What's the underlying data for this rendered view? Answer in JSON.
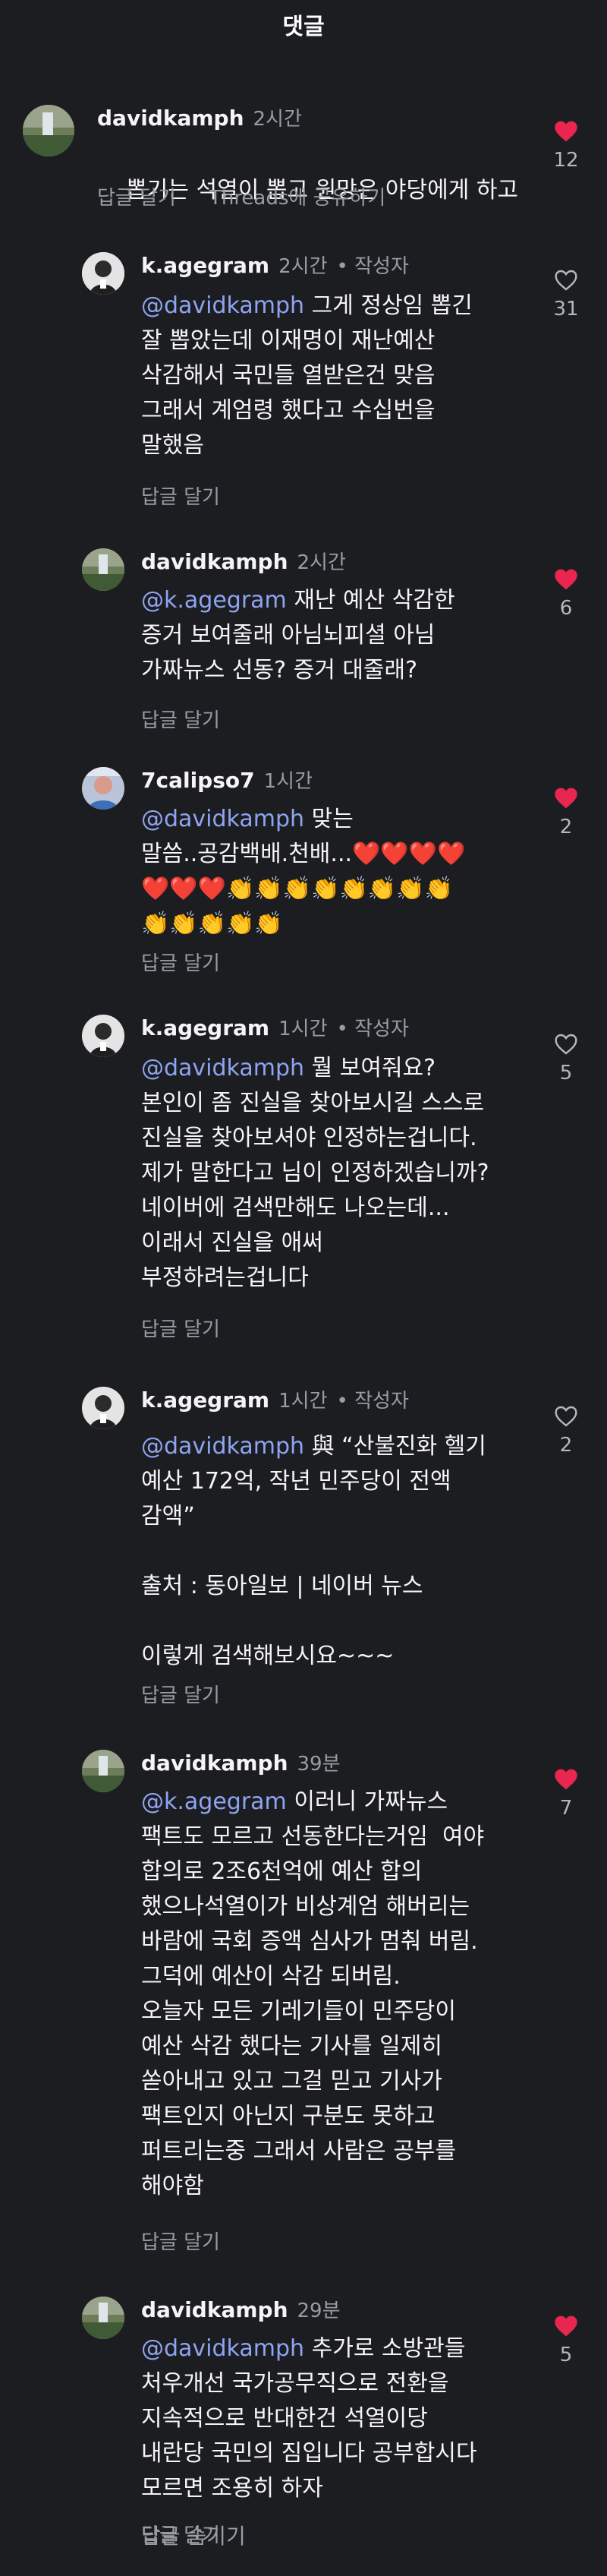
{
  "header": {
    "title": "댓글"
  },
  "colors": {
    "like_active": "#e8264f",
    "mention": "#8ea4f0",
    "background": "#1c1d21"
  },
  "icons": {
    "like_active": "heart-filled-icon",
    "like_inactive": "heart-outline-icon"
  },
  "comments": [
    {
      "user": "davidkamph",
      "time": "2시간",
      "author_tag": "",
      "mention": "",
      "text": "뽑기는 석열이 뽑고 원망은 야당에게 하고",
      "actions": [
        "답글 달기",
        "Threads에 공유하기"
      ],
      "likes": "12",
      "liked": true
    },
    {
      "user": "k.agegram",
      "time": "2시간",
      "author_tag": "• 작성자",
      "mention": "@davidkamph",
      "text": " 그게 정상임 뽑긴\n잘 뽑았는데 이재명이 재난예산\n삭감해서 국민들 열받은건 맞음\n그래서 계엄령 했다고 수십번을\n말했음",
      "actions": [
        "답글 달기"
      ],
      "likes": "31",
      "liked": false
    },
    {
      "user": "davidkamph",
      "time": "2시간",
      "author_tag": "",
      "mention": "@k.agegram",
      "text": " 재난 예산 삭감한\n증거 보여줄래 아님뇌피셜 아님\n가짜뉴스 선동? 증거 대줄래?",
      "actions": [
        "답글 달기"
      ],
      "likes": "6",
      "liked": true
    },
    {
      "user": "7calipso7",
      "time": "1시간",
      "author_tag": "",
      "mention": "@davidkamph",
      "text": " 맞는\n말씀..공감백배.천배...❤️❤️❤️❤️\n❤️❤️❤️👏👏👏👏👏👏👏👏\n👏👏👏👏👏",
      "actions": [
        "답글 달기"
      ],
      "likes": "2",
      "liked": true
    },
    {
      "user": "k.agegram",
      "time": "1시간",
      "author_tag": "• 작성자",
      "mention": "@davidkamph",
      "text": " 뭘 보여줘요?\n본인이 좀 진실을 찾아보시길 스스로\n진실을 찾아보셔야 인정하는겁니다.\n제가 말한다고 님이 인정하겠습니까?\n네이버에 검색만해도 나오는데...\n이래서 진실을 애써\n부정하려는겁니다",
      "actions": [
        "답글 달기"
      ],
      "likes": "5",
      "liked": false
    },
    {
      "user": "k.agegram",
      "time": "1시간",
      "author_tag": "• 작성자",
      "mention": "@davidkamph",
      "text": " 與 “산불진화 헬기\n예산 172억, 작년 민주당이 전액\n감액”\n\n출처 : 동아일보 | 네이버 뉴스\n\n이렇게 검색해보시요~~~",
      "actions": [
        "답글 달기"
      ],
      "likes": "2",
      "liked": false
    },
    {
      "user": "davidkamph",
      "time": "39분",
      "author_tag": "",
      "mention": "@k.agegram",
      "text": " 이러니 가짜뉴스\n팩트도 모르고 선동한다는거임  여야\n합의로 2조6천억에 예산 합의\n했으나석열이가 비상계엄 해버리는\n바람에 국회 증액 심사가 멈춰 버림.\n그덕에 예산이 삭감 되버림.\n오늘자 모든 기레기들이 민주당이\n예산 삭감 했다는 기사를 일제히\n쏟아내고 있고 그걸 믿고 기사가\n팩트인지 아닌지 구분도 못하고\n퍼트리는중 그래서 사람은 공부를\n해야함",
      "actions": [
        "답글 달기"
      ],
      "likes": "7",
      "liked": true
    },
    {
      "user": "davidkamph",
      "time": "29분",
      "author_tag": "",
      "mention": "@davidkamph",
      "text": " 추가로 소방관들\n처우개선 국가공무직으로 전환을\n지속적으로 반대한건 석열이당\n내란당 국민의 짐입니다 공부합시다\n모르면 조용히 하자",
      "actions": [
        "답글 달기"
      ],
      "likes": "5",
      "liked": true
    }
  ],
  "footer": {
    "hide_replies": "답글 숨기기"
  }
}
